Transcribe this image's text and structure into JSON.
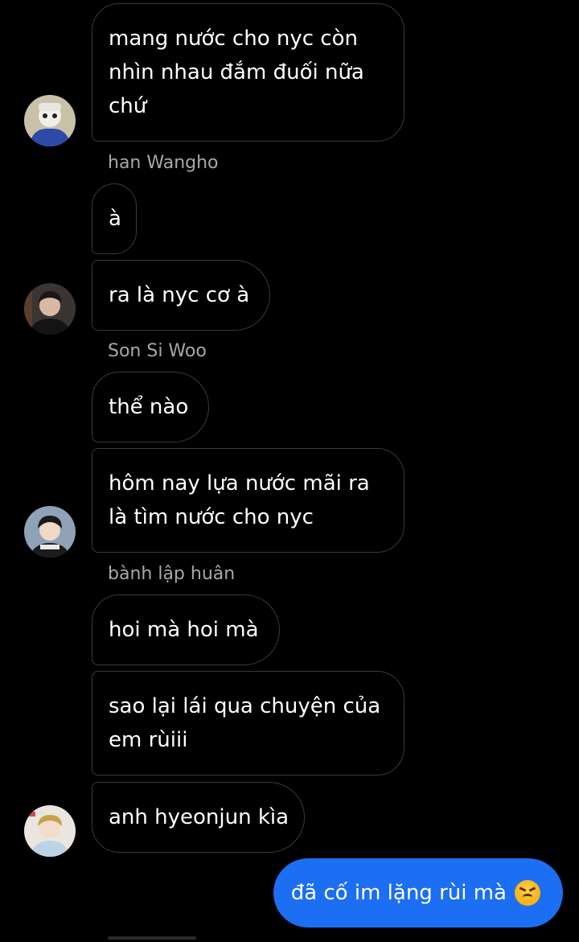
{
  "messages": [
    {
      "text": "mang nước cho nyc còn\nnhìn nhau đắm đuối nữa\nchứ"
    },
    {
      "sender": "han Wangho"
    },
    {
      "text": "à"
    },
    {
      "text": "ra là nyc cơ à"
    },
    {
      "sender": "Son Si Woo"
    },
    {
      "text": "thể nào"
    },
    {
      "text": "hôm nay lựa nước mãi ra\nlà tìm nước cho nyc"
    },
    {
      "sender": "bành lập huân"
    },
    {
      "text": "hoi mà hoi mà"
    },
    {
      "text": "sao lại lái qua chuyện của\nem rùiii"
    },
    {
      "text": "anh hyeonjun kìa"
    }
  ],
  "outgoing": {
    "text": "đã cố im lặng rùi mà",
    "emoji": "angry-face-emoji",
    "color": "#1c6ef2"
  },
  "colors": {
    "background": "#000000",
    "bubble_border": "#3a3a3a",
    "sender_name": "#a8a8a8"
  }
}
